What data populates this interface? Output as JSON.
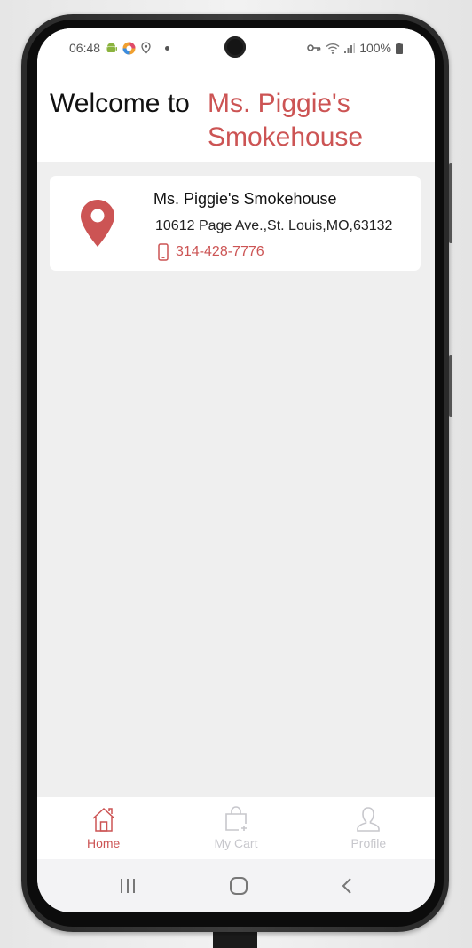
{
  "status_bar": {
    "time": "06:48",
    "battery": "100%",
    "icons_left": [
      "android-icon",
      "chrome-app-icon",
      "location-icon",
      "dot-icon"
    ],
    "icons_right": [
      "vpn-key-icon",
      "wifi-icon",
      "signal-icon",
      "battery-icon"
    ]
  },
  "header": {
    "welcome_text": "Welcome to",
    "brand_line1": "Ms. Piggie's",
    "brand_line2": "Smokehouse",
    "brand_color": "#cc5454"
  },
  "location_card": {
    "name": "Ms. Piggie's Smokehouse",
    "address": "10612 Page Ave.,St. Louis,MO,63132",
    "phone": "314-428-7776",
    "icon": "map-pin-icon",
    "phone_icon": "mobile-phone-icon"
  },
  "tabs": [
    {
      "label": "Home",
      "icon": "home-icon",
      "active": true
    },
    {
      "label": "My Cart",
      "icon": "shopping-bag-icon",
      "active": false
    },
    {
      "label": "Profile",
      "icon": "user-icon",
      "active": false
    }
  ],
  "colors": {
    "accent": "#cc5454",
    "inactive": "#c7c7cc",
    "background": "#efefef"
  }
}
